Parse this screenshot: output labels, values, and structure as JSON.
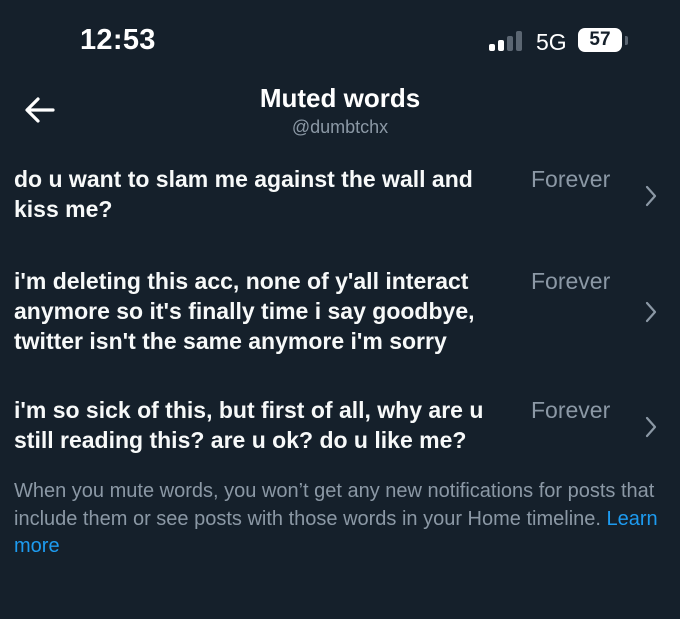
{
  "status_bar": {
    "time": "12:53",
    "network": "5G",
    "battery": "57",
    "icons": [
      "signal-icon",
      "battery-icon"
    ]
  },
  "header": {
    "back_icon": "arrow-left-icon",
    "title": "Muted words",
    "handle": "@dumbtchx"
  },
  "muted_words": [
    {
      "text": "do u want to slam me against the wall and kiss me?",
      "duration": "Forever"
    },
    {
      "text": "i'm deleting this acc, none of y'all interact anymore so it's finally time i say goodbye, twitter isn't the same anymore i'm sorry",
      "duration": "Forever"
    },
    {
      "text": "i'm so sick of this, but first of all, why are u still reading this? are u ok? do u like me?",
      "duration": "Forever"
    }
  ],
  "footer": {
    "note": "When you mute words, you won’t get any new notifications for posts that include them or see posts with those words in your Home timeline.",
    "link_label": "Learn more"
  },
  "colors": {
    "background": "#15202b",
    "secondary_text": "#8b98a5",
    "link": "#1d9bf0"
  }
}
